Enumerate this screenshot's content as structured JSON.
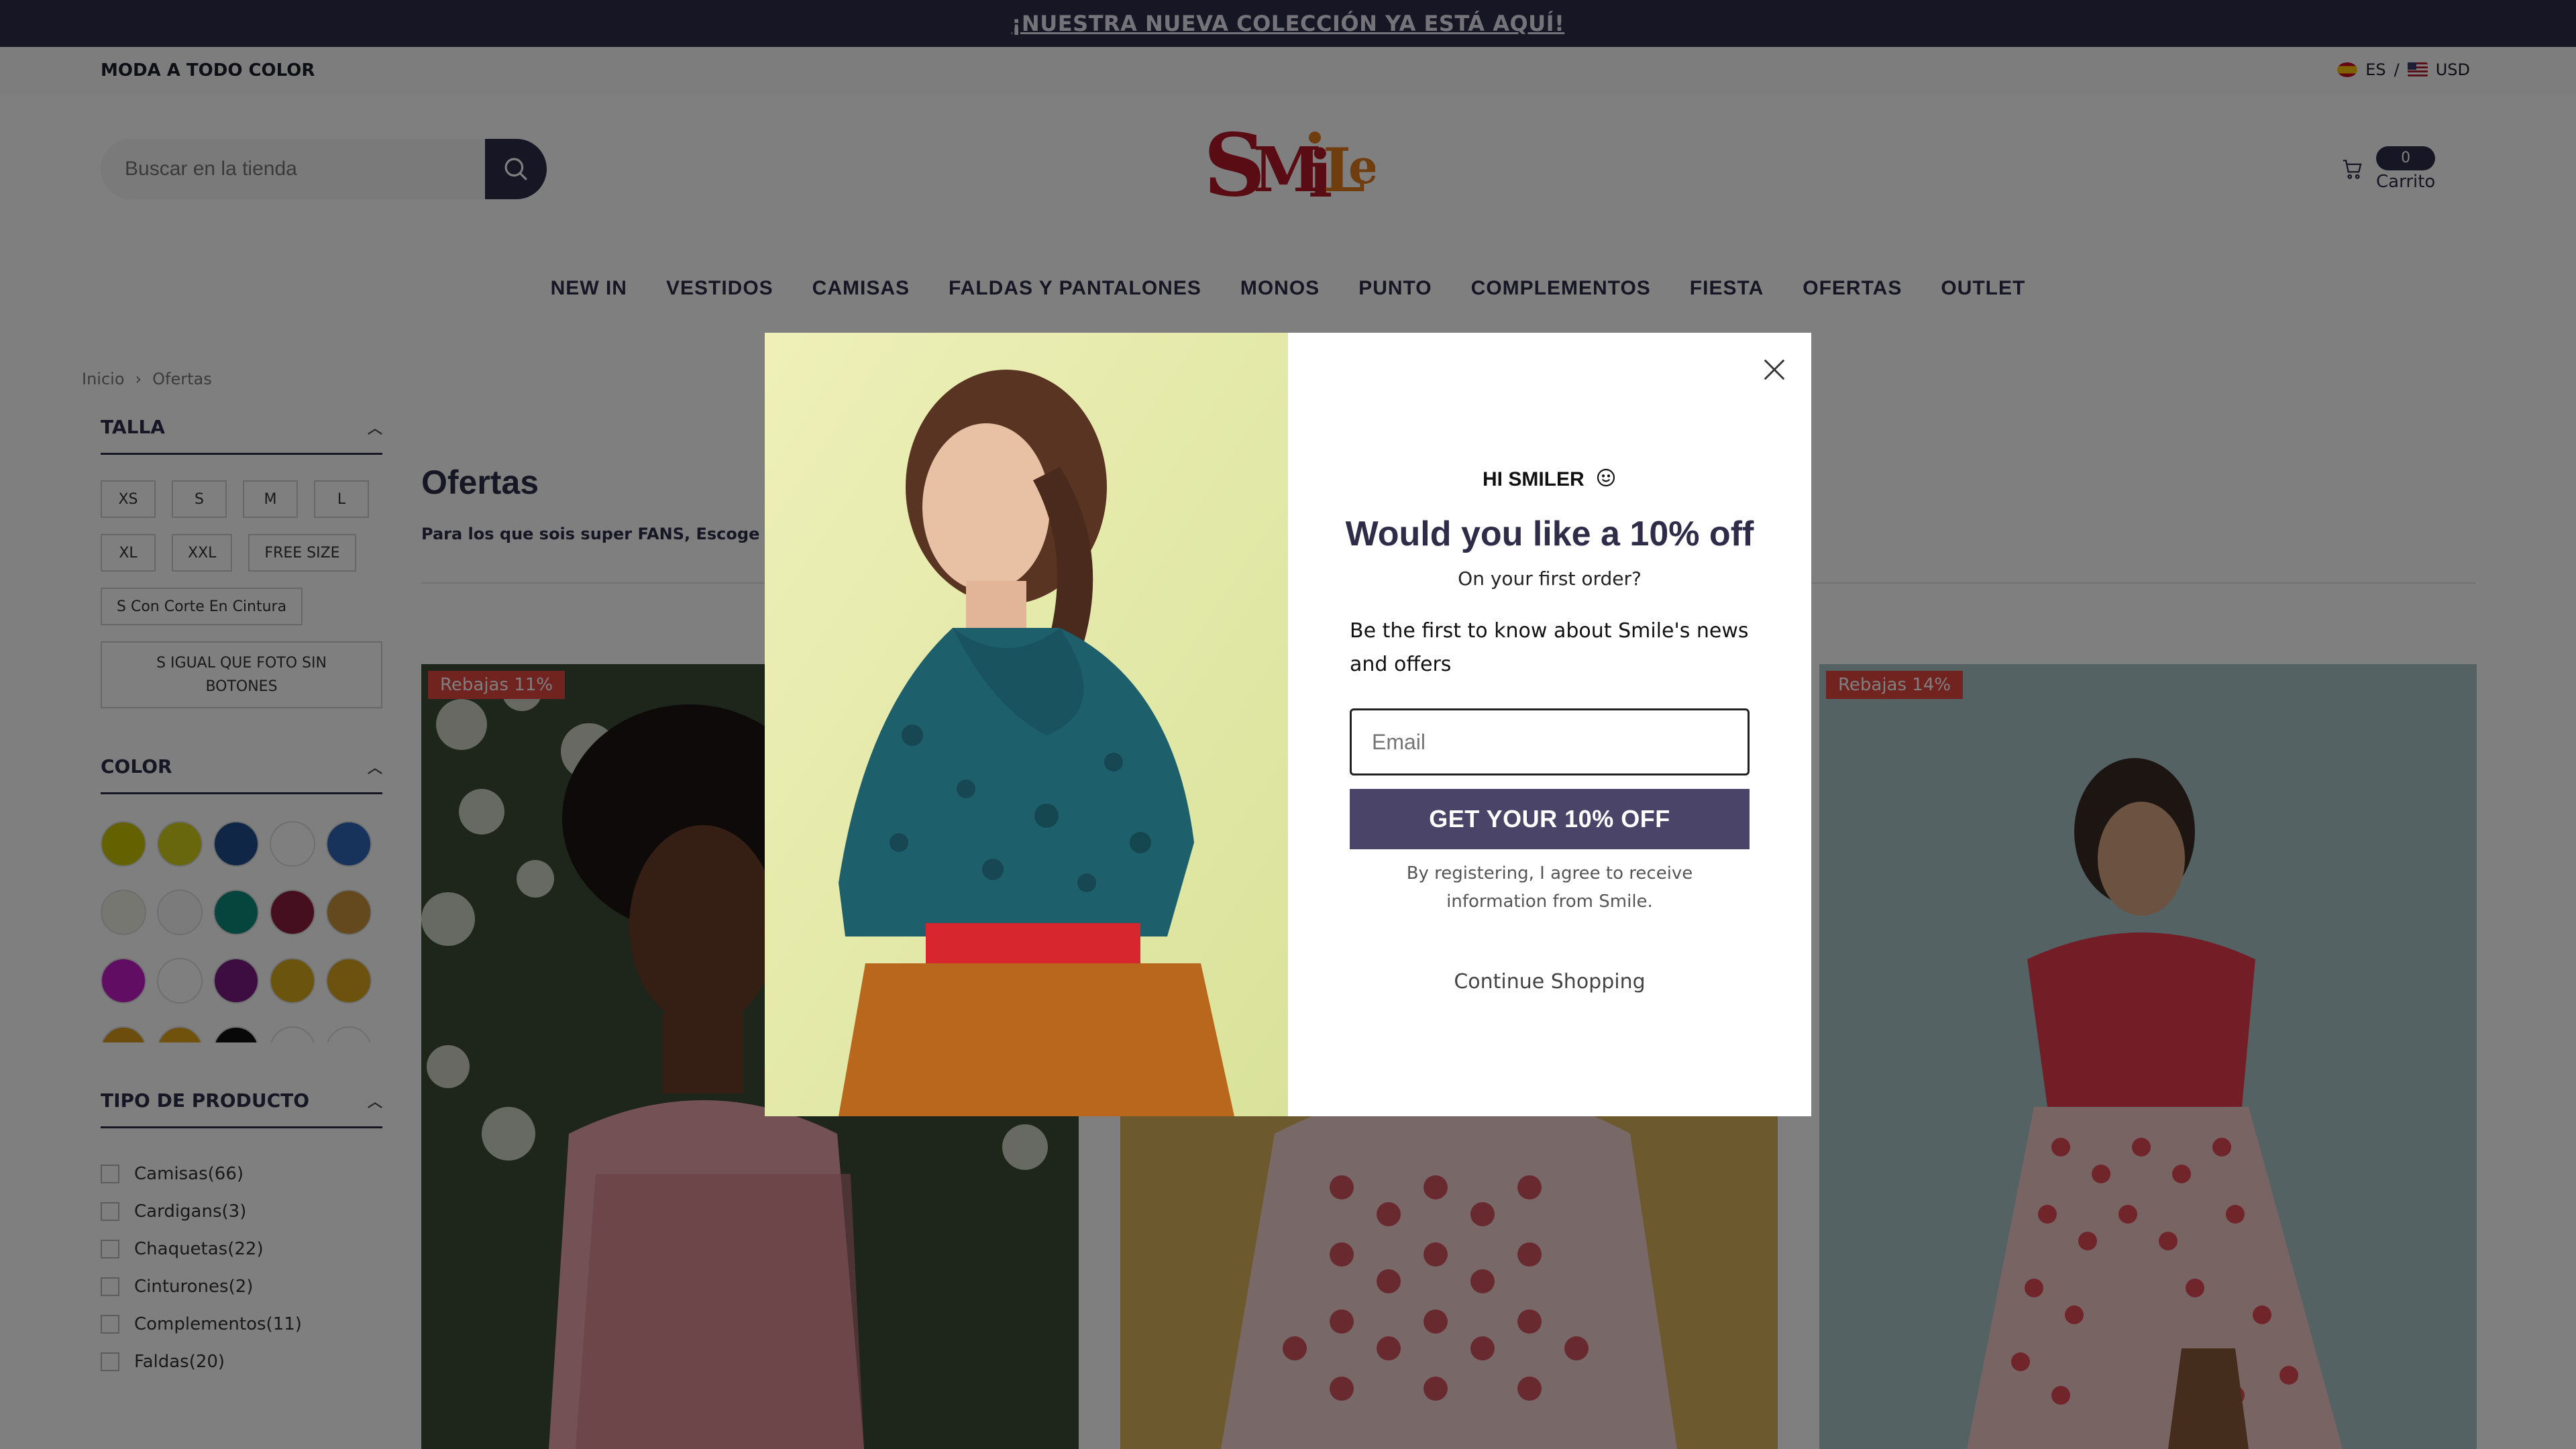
{
  "announcement": {
    "text": "¡NUESTRA NUEVA COLECCIÓN YA ESTÁ AQUÍ!"
  },
  "topbar": {
    "tagline": "MODA A TODO COLOR",
    "language": "ES",
    "separator": "/",
    "currency": "USD"
  },
  "header": {
    "search_placeholder": "Buscar en la tienda",
    "logo_text": "SMILE",
    "cart_count": "0",
    "cart_label": "Carrito"
  },
  "nav": {
    "items": [
      "NEW IN",
      "VESTIDOS",
      "CAMISAS",
      "FALDAS Y PANTALONES",
      "MONOS",
      "PUNTO",
      "COMPLEMENTOS",
      "FIESTA",
      "OFERTAS",
      "OUTLET"
    ]
  },
  "breadcrumb": {
    "home": "Inicio",
    "separator": "›",
    "current": "Ofertas"
  },
  "filters": {
    "size": {
      "title": "TALLA",
      "options": [
        "XS",
        "S",
        "M",
        "L",
        "XL",
        "XXL",
        "FREE SIZE",
        "S Con Corte En Cintura",
        "S IGUAL QUE FOTO SIN BOTONES"
      ]
    },
    "color": {
      "title": "COLOR",
      "swatches": [
        "#c8c400",
        "#d2cf1a",
        "#1e4d8c",
        "#ffffff",
        "#2f66b8",
        "#efefe2",
        "#f7f7f7",
        "#0d8a7a",
        "#8a1f3e",
        "#c9903c",
        "#c21ac9",
        "#ffffff",
        "#7a1882",
        "#d5a81c",
        "#d8a41c",
        "#d89a1a",
        "#e0a51a",
        "#111111",
        "#ffffff",
        "#ffffff"
      ]
    },
    "product_type": {
      "title": "TIPO DE PRODUCTO",
      "items": [
        "Camisas(66)",
        "Cardigans(3)",
        "Chaquetas(22)",
        "Cinturones(2)",
        "Complementos(11)",
        "Faldas(20)"
      ]
    }
  },
  "main": {
    "title": "Ofertas",
    "description": "Para los que sois super FANS, Escoge tre",
    "products": [
      {
        "badge": "Rebajas 11%"
      },
      {
        "badge": ""
      },
      {
        "badge": "Rebajas 14%"
      }
    ]
  },
  "popup": {
    "greeting": "HI SMILER",
    "greeting_icon": "smiley-icon",
    "headline": "Would you like a 10% off",
    "subheadline": "On your first order?",
    "pitch": "Be the first to know about Smile's news and offers",
    "email_placeholder": "Email",
    "cta_label": "GET YOUR 10% OFF",
    "disclaimer": "By registering, I agree to receive information from Smile.",
    "continue_label": "Continue Shopping"
  },
  "colors": {
    "brand_dark": "#2f2c4a",
    "cta": "#4a4468",
    "badge": "#e0463e",
    "logo_red": "#b5182a",
    "logo_orange": "#e07a1f"
  }
}
